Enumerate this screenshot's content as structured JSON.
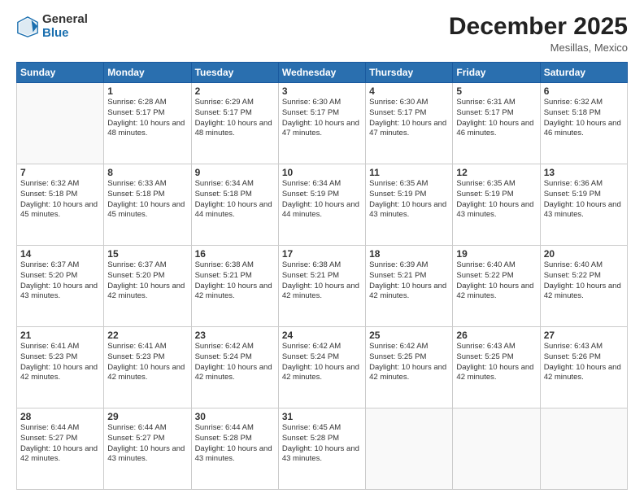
{
  "header": {
    "logo_general": "General",
    "logo_blue": "Blue",
    "month_title": "December 2025",
    "location": "Mesillas, Mexico"
  },
  "days_of_week": [
    "Sunday",
    "Monday",
    "Tuesday",
    "Wednesday",
    "Thursday",
    "Friday",
    "Saturday"
  ],
  "weeks": [
    [
      {
        "day": "",
        "info": ""
      },
      {
        "day": "1",
        "info": "Sunrise: 6:28 AM\nSunset: 5:17 PM\nDaylight: 10 hours and 48 minutes."
      },
      {
        "day": "2",
        "info": "Sunrise: 6:29 AM\nSunset: 5:17 PM\nDaylight: 10 hours and 48 minutes."
      },
      {
        "day": "3",
        "info": "Sunrise: 6:30 AM\nSunset: 5:17 PM\nDaylight: 10 hours and 47 minutes."
      },
      {
        "day": "4",
        "info": "Sunrise: 6:30 AM\nSunset: 5:17 PM\nDaylight: 10 hours and 47 minutes."
      },
      {
        "day": "5",
        "info": "Sunrise: 6:31 AM\nSunset: 5:17 PM\nDaylight: 10 hours and 46 minutes."
      },
      {
        "day": "6",
        "info": "Sunrise: 6:32 AM\nSunset: 5:18 PM\nDaylight: 10 hours and 46 minutes."
      }
    ],
    [
      {
        "day": "7",
        "info": "Sunrise: 6:32 AM\nSunset: 5:18 PM\nDaylight: 10 hours and 45 minutes."
      },
      {
        "day": "8",
        "info": "Sunrise: 6:33 AM\nSunset: 5:18 PM\nDaylight: 10 hours and 45 minutes."
      },
      {
        "day": "9",
        "info": "Sunrise: 6:34 AM\nSunset: 5:18 PM\nDaylight: 10 hours and 44 minutes."
      },
      {
        "day": "10",
        "info": "Sunrise: 6:34 AM\nSunset: 5:19 PM\nDaylight: 10 hours and 44 minutes."
      },
      {
        "day": "11",
        "info": "Sunrise: 6:35 AM\nSunset: 5:19 PM\nDaylight: 10 hours and 43 minutes."
      },
      {
        "day": "12",
        "info": "Sunrise: 6:35 AM\nSunset: 5:19 PM\nDaylight: 10 hours and 43 minutes."
      },
      {
        "day": "13",
        "info": "Sunrise: 6:36 AM\nSunset: 5:19 PM\nDaylight: 10 hours and 43 minutes."
      }
    ],
    [
      {
        "day": "14",
        "info": "Sunrise: 6:37 AM\nSunset: 5:20 PM\nDaylight: 10 hours and 43 minutes."
      },
      {
        "day": "15",
        "info": "Sunrise: 6:37 AM\nSunset: 5:20 PM\nDaylight: 10 hours and 42 minutes."
      },
      {
        "day": "16",
        "info": "Sunrise: 6:38 AM\nSunset: 5:21 PM\nDaylight: 10 hours and 42 minutes."
      },
      {
        "day": "17",
        "info": "Sunrise: 6:38 AM\nSunset: 5:21 PM\nDaylight: 10 hours and 42 minutes."
      },
      {
        "day": "18",
        "info": "Sunrise: 6:39 AM\nSunset: 5:21 PM\nDaylight: 10 hours and 42 minutes."
      },
      {
        "day": "19",
        "info": "Sunrise: 6:40 AM\nSunset: 5:22 PM\nDaylight: 10 hours and 42 minutes."
      },
      {
        "day": "20",
        "info": "Sunrise: 6:40 AM\nSunset: 5:22 PM\nDaylight: 10 hours and 42 minutes."
      }
    ],
    [
      {
        "day": "21",
        "info": "Sunrise: 6:41 AM\nSunset: 5:23 PM\nDaylight: 10 hours and 42 minutes."
      },
      {
        "day": "22",
        "info": "Sunrise: 6:41 AM\nSunset: 5:23 PM\nDaylight: 10 hours and 42 minutes."
      },
      {
        "day": "23",
        "info": "Sunrise: 6:42 AM\nSunset: 5:24 PM\nDaylight: 10 hours and 42 minutes."
      },
      {
        "day": "24",
        "info": "Sunrise: 6:42 AM\nSunset: 5:24 PM\nDaylight: 10 hours and 42 minutes."
      },
      {
        "day": "25",
        "info": "Sunrise: 6:42 AM\nSunset: 5:25 PM\nDaylight: 10 hours and 42 minutes."
      },
      {
        "day": "26",
        "info": "Sunrise: 6:43 AM\nSunset: 5:25 PM\nDaylight: 10 hours and 42 minutes."
      },
      {
        "day": "27",
        "info": "Sunrise: 6:43 AM\nSunset: 5:26 PM\nDaylight: 10 hours and 42 minutes."
      }
    ],
    [
      {
        "day": "28",
        "info": "Sunrise: 6:44 AM\nSunset: 5:27 PM\nDaylight: 10 hours and 42 minutes."
      },
      {
        "day": "29",
        "info": "Sunrise: 6:44 AM\nSunset: 5:27 PM\nDaylight: 10 hours and 43 minutes."
      },
      {
        "day": "30",
        "info": "Sunrise: 6:44 AM\nSunset: 5:28 PM\nDaylight: 10 hours and 43 minutes."
      },
      {
        "day": "31",
        "info": "Sunrise: 6:45 AM\nSunset: 5:28 PM\nDaylight: 10 hours and 43 minutes."
      },
      {
        "day": "",
        "info": ""
      },
      {
        "day": "",
        "info": ""
      },
      {
        "day": "",
        "info": ""
      }
    ]
  ]
}
